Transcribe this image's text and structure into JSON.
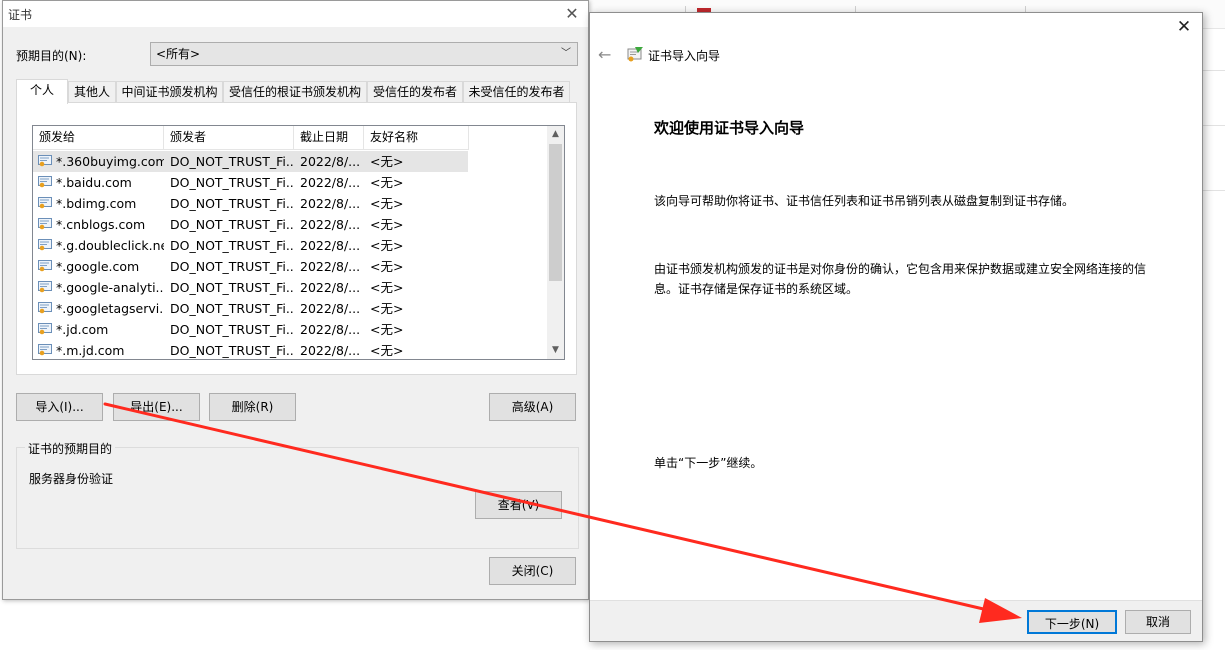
{
  "cert_dialog": {
    "title": "证书",
    "purpose_label": "预期目的(N):",
    "purpose_value": "<所有>",
    "tabs": [
      {
        "label": "个人"
      },
      {
        "label": "其他人"
      },
      {
        "label": "中间证书颁发机构"
      },
      {
        "label": "受信任的根证书颁发机构"
      },
      {
        "label": "受信任的发布者"
      },
      {
        "label": "未受信任的发布者"
      }
    ],
    "columns": [
      "颁发给",
      "颁发者",
      "截止日期",
      "友好名称"
    ],
    "rows": [
      {
        "issued_to": "*.360buyimg.com",
        "issuer": "DO_NOT_TRUST_Fi...",
        "expiry": "2022/8/...",
        "friendly": "<无>"
      },
      {
        "issued_to": "*.baidu.com",
        "issuer": "DO_NOT_TRUST_Fi...",
        "expiry": "2022/8/...",
        "friendly": "<无>"
      },
      {
        "issued_to": "*.bdimg.com",
        "issuer": "DO_NOT_TRUST_Fi...",
        "expiry": "2022/8/...",
        "friendly": "<无>"
      },
      {
        "issued_to": "*.cnblogs.com",
        "issuer": "DO_NOT_TRUST_Fi...",
        "expiry": "2022/8/...",
        "friendly": "<无>"
      },
      {
        "issued_to": "*.g.doubleclick.net",
        "issuer": "DO_NOT_TRUST_Fi...",
        "expiry": "2022/8/...",
        "friendly": "<无>"
      },
      {
        "issued_to": "*.google.com",
        "issuer": "DO_NOT_TRUST_Fi...",
        "expiry": "2022/8/...",
        "friendly": "<无>"
      },
      {
        "issued_to": "*.google-analyti...",
        "issuer": "DO_NOT_TRUST_Fi...",
        "expiry": "2022/8/...",
        "friendly": "<无>"
      },
      {
        "issued_to": "*.googletagservi...",
        "issuer": "DO_NOT_TRUST_Fi...",
        "expiry": "2022/8/...",
        "friendly": "<无>"
      },
      {
        "issued_to": "*.jd.com",
        "issuer": "DO_NOT_TRUST_Fi...",
        "expiry": "2022/8/...",
        "friendly": "<无>"
      },
      {
        "issued_to": "*.m.jd.com",
        "issuer": "DO_NOT_TRUST_Fi...",
        "expiry": "2022/8/...",
        "friendly": "<无>"
      }
    ],
    "buttons": {
      "import": "导入(I)...",
      "export": "导出(E)...",
      "remove": "删除(R)",
      "advanced": "高级(A)",
      "view": "查看(V)",
      "close": "关闭(C)"
    },
    "purpose_group_label": "证书的预期目的",
    "purpose_group_value": "服务器身份验证"
  },
  "wizard": {
    "title": "证书导入向导",
    "heading": "欢迎使用证书导入向导",
    "para1": "该向导可帮助你将证书、证书信任列表和证书吊销列表从磁盘复制到证书存储。",
    "para2": "由证书颁发机构颁发的证书是对你身份的确认，它包含用来保护数据或建立安全网络连接的信息。证书存储是保存证书的系统区域。",
    "para3": "单击“下一步”继续。",
    "next_label": "下一步(N)",
    "cancel_label": "取消"
  },
  "colors": {
    "accent": "#0078d7",
    "annotation_arrow": "#ff2a1f",
    "dialog_bg": "#f0f0f0"
  }
}
